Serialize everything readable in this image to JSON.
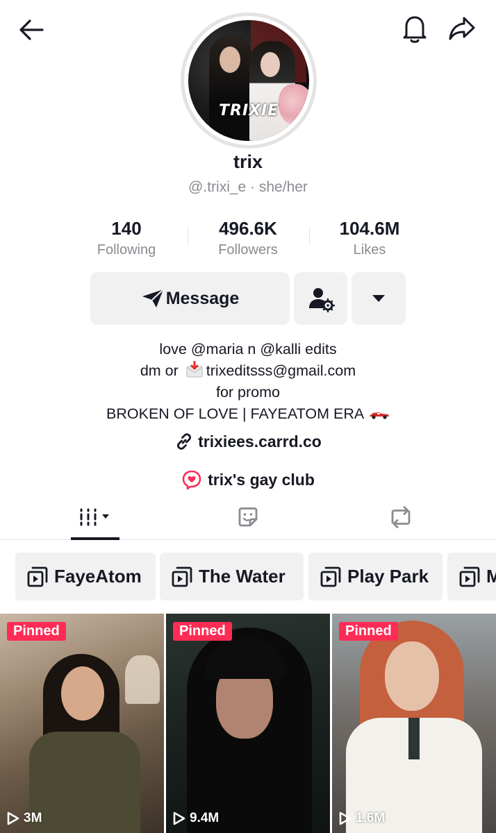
{
  "header": {
    "back_icon": "arrow-left-icon",
    "notification_icon": "bell-icon",
    "share_icon": "share-arrow-icon"
  },
  "profile": {
    "avatar_text": "TRIXIE",
    "display_name": "trix",
    "handle_line": "@.trixi_e · she/her"
  },
  "stats": [
    {
      "value": "140",
      "label": "Following"
    },
    {
      "value": "496.6K",
      "label": "Followers"
    },
    {
      "value": "104.6M",
      "label": "Likes"
    }
  ],
  "actions": {
    "message_label": "Message",
    "message_icon": "paper-plane-icon",
    "friends_icon": "user-settings-icon",
    "more_icon": "triangle-down-icon"
  },
  "bio": {
    "line1": "love @maria n @kalli edits",
    "line2_prefix": "dm or",
    "line2_email": "trixeditsss@gmail.com",
    "line3": "for promo",
    "line4": "BROKEN OF LOVE | FAYEATOM ERA"
  },
  "link": {
    "text": "trixiees.carrd.co",
    "icon": "link-icon"
  },
  "group": {
    "text": "trix's gay club",
    "icon": "chat-heart-icon",
    "icon_color": "#fe2c55"
  },
  "tabs": [
    {
      "name": "videos",
      "icon": "grid-lines-icon",
      "active": true
    },
    {
      "name": "stickers",
      "icon": "sticker-icon",
      "active": false
    },
    {
      "name": "reposts",
      "icon": "repost-icon",
      "active": false
    }
  ],
  "playlists": [
    {
      "label": "FayeAtom"
    },
    {
      "label": "The Water"
    },
    {
      "label": "Play Park"
    },
    {
      "label": "M"
    }
  ],
  "videos": [
    {
      "badge": "Pinned",
      "views": "3M"
    },
    {
      "badge": "Pinned",
      "views": "9.4M"
    },
    {
      "badge": "Pinned",
      "views": "1.6M"
    }
  ],
  "colors": {
    "accent": "#fe2c55",
    "text": "#161823",
    "secondary_text": "#8a8b91",
    "button_bg": "#f1f1f2"
  }
}
